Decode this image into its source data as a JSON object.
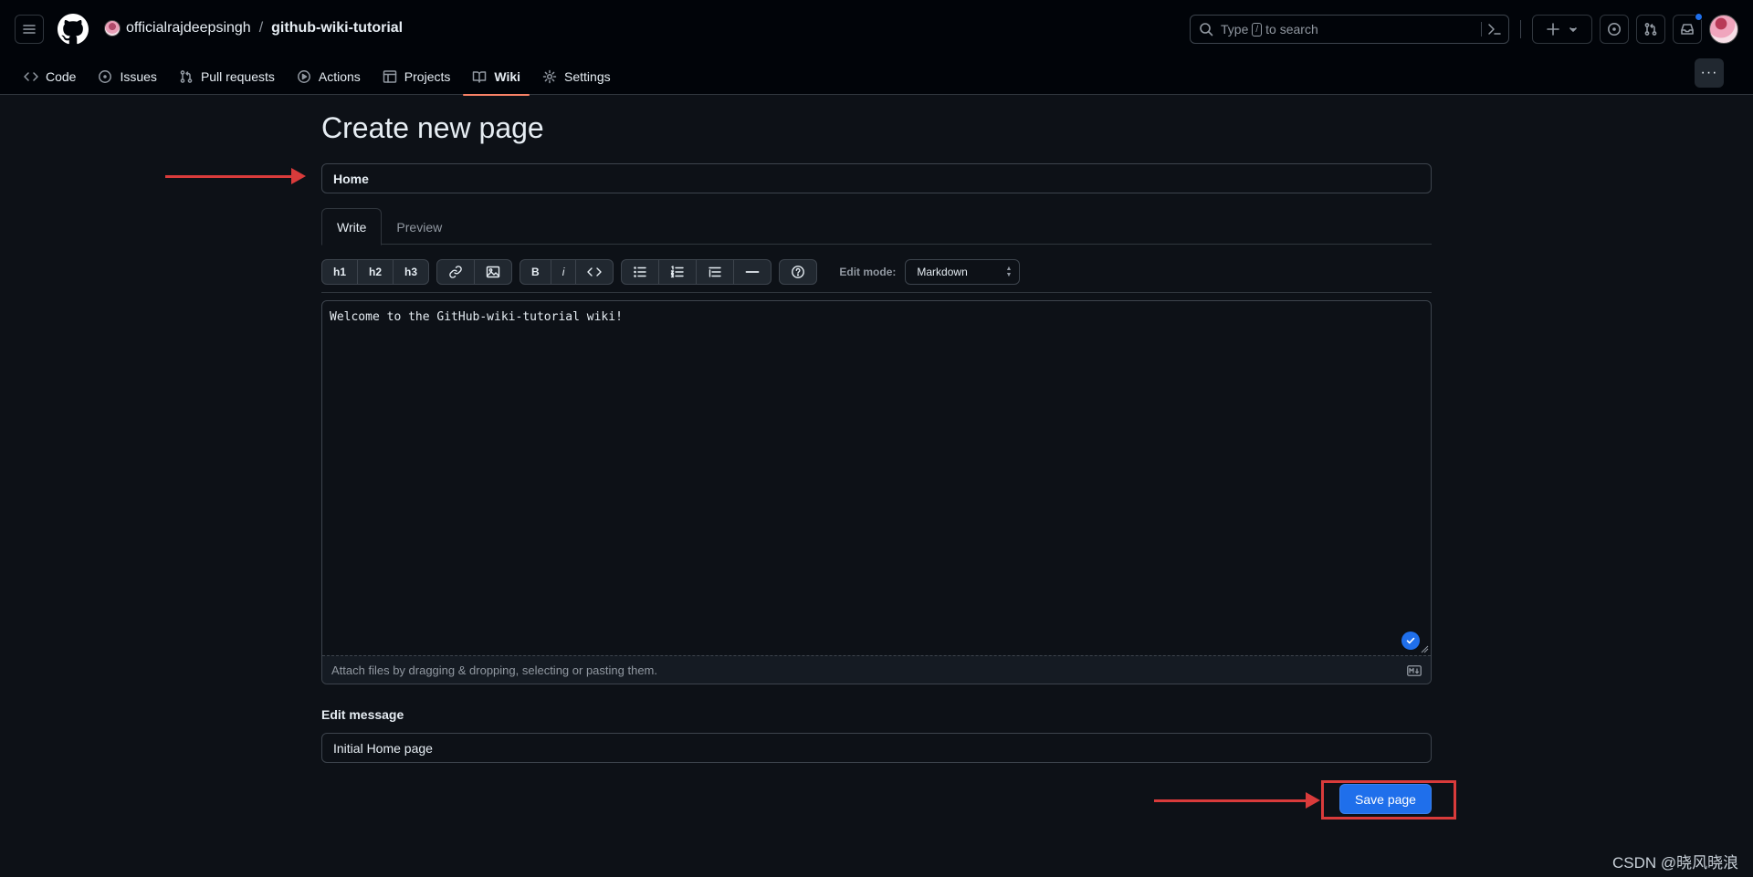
{
  "header": {
    "owner": "officialrajdeepsingh",
    "separator": "/",
    "repo": "github-wiki-tutorial",
    "search": {
      "prefix": "Type",
      "key": "/",
      "suffix": "to search"
    }
  },
  "nav": {
    "tabs": [
      {
        "label": "Code",
        "icon": "code-icon"
      },
      {
        "label": "Issues",
        "icon": "issue-opened-icon"
      },
      {
        "label": "Pull requests",
        "icon": "git-pull-request-icon"
      },
      {
        "label": "Actions",
        "icon": "play-icon"
      },
      {
        "label": "Projects",
        "icon": "table-icon"
      },
      {
        "label": "Wiki",
        "icon": "book-icon",
        "active": true
      },
      {
        "label": "Settings",
        "icon": "gear-icon"
      }
    ],
    "more_label": "···"
  },
  "page": {
    "title": "Create new page",
    "page_title_value": "Home",
    "editor_tabs": {
      "write": "Write",
      "preview": "Preview"
    },
    "toolbar": {
      "h1": "h1",
      "h2": "h2",
      "h3": "h3",
      "bold": "B",
      "italic": "i",
      "edit_mode_label": "Edit mode:",
      "edit_mode_value": "Markdown"
    },
    "content": "Welcome to the GitHub-wiki-tutorial wiki!",
    "attach_hint": "Attach files by dragging & dropping, selecting or pasting them.",
    "edit_message_label": "Edit message",
    "edit_message_value": "Initial Home page",
    "save_label": "Save page"
  },
  "colors": {
    "accent": "#1f6feb",
    "annotation": "#d93b3b",
    "tab_underline": "#f78166",
    "notification_dot": "#1f6feb"
  },
  "watermark": "CSDN @晓风晓浪"
}
